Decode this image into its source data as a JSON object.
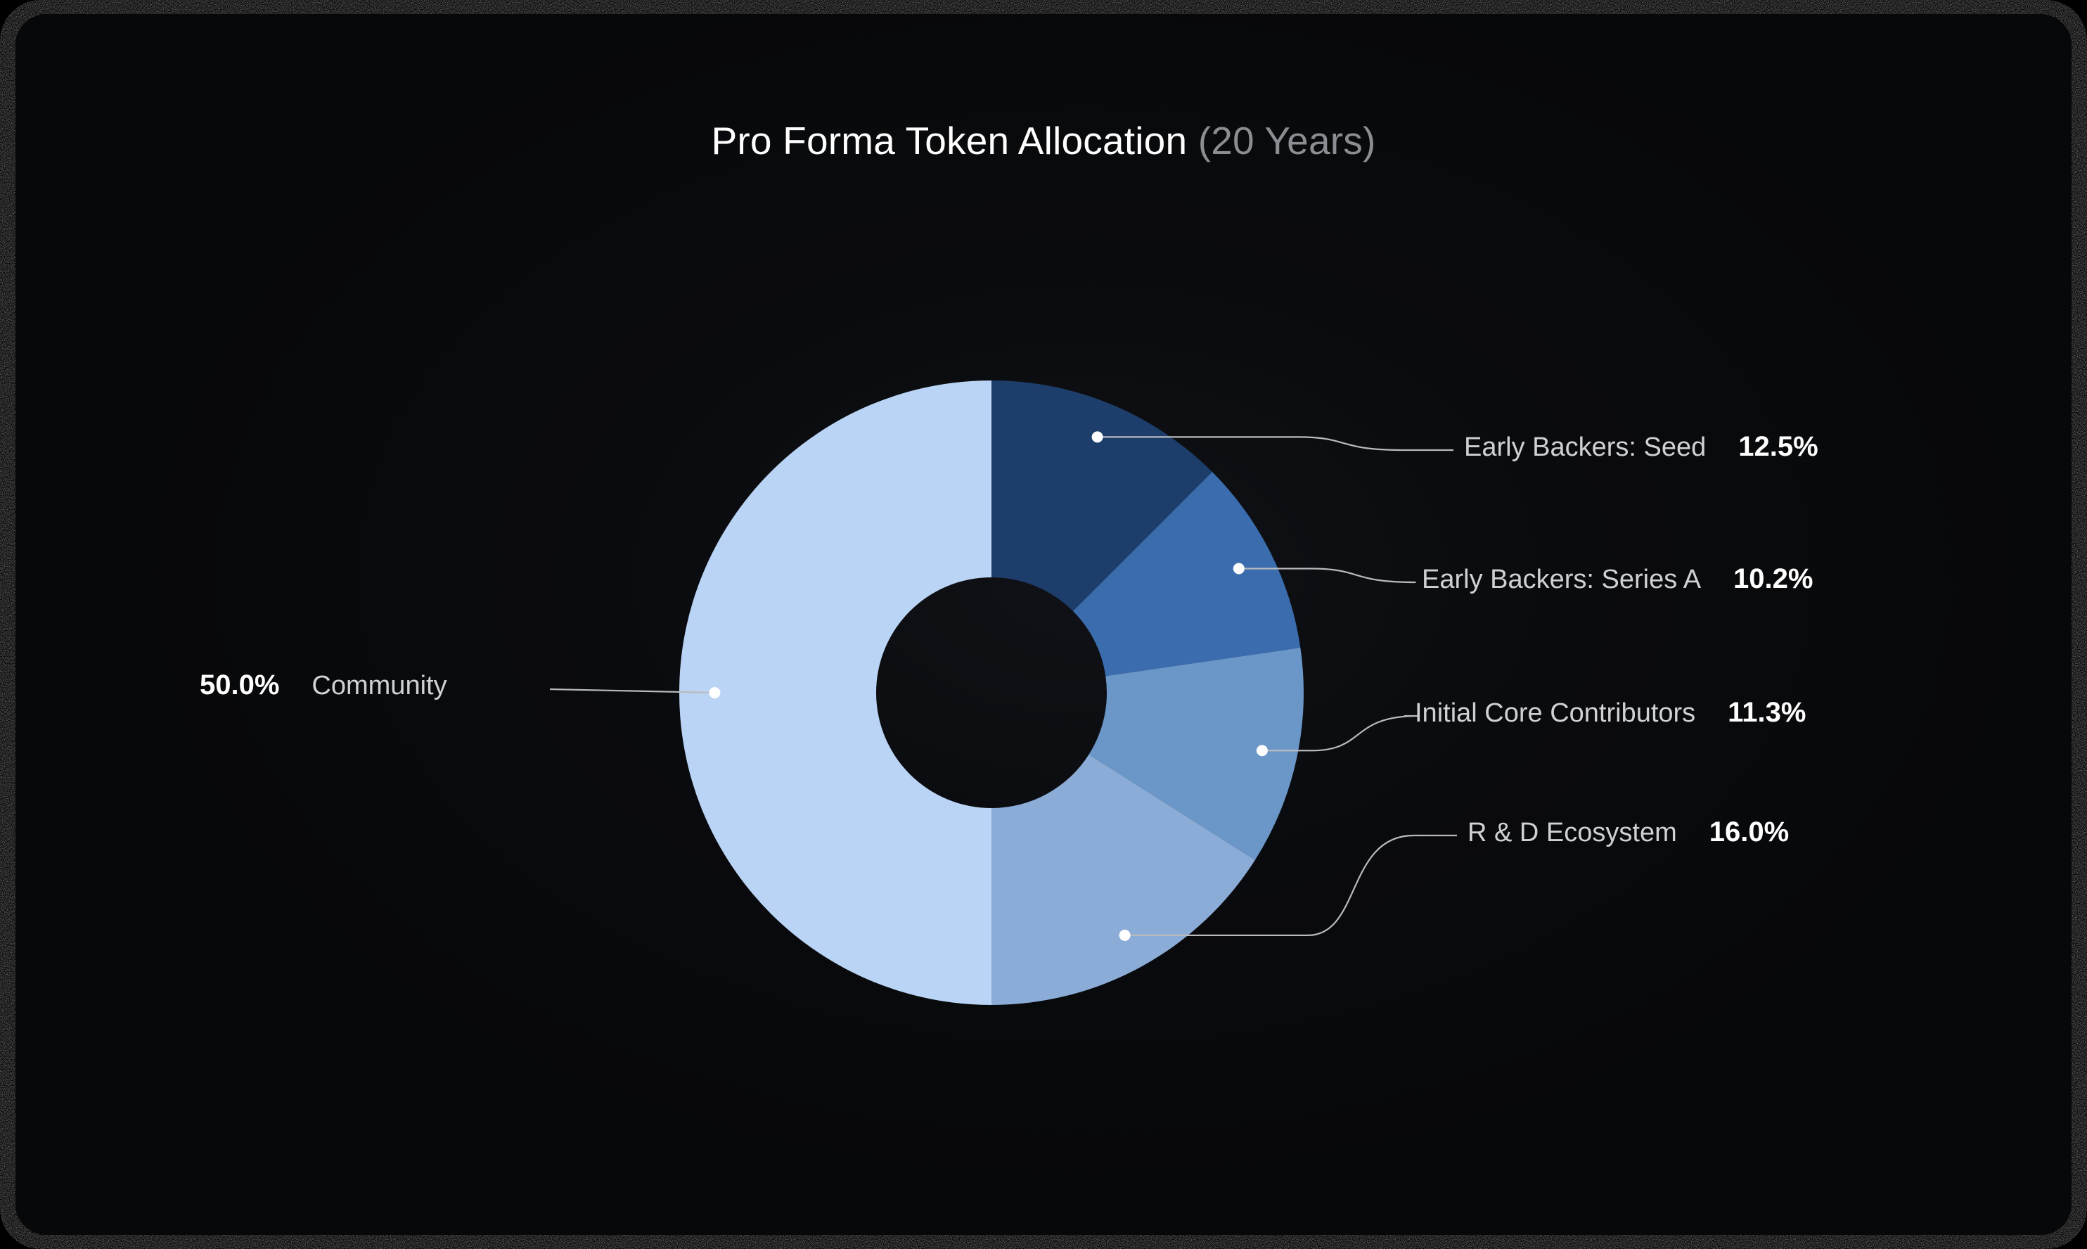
{
  "title": {
    "main": "Pro Forma Token Allocation",
    "sub": "(20 Years)"
  },
  "colors": {
    "background": "#0A0B0E",
    "panel": "#0E1015",
    "frame": "#FFFFFF",
    "label_name": "#CFD1D4",
    "label_value": "#FFFFFF",
    "connector": "#B9BBBE",
    "dot": "#FFFFFF"
  },
  "chart_data": {
    "type": "pie",
    "variant": "donut",
    "title": "Pro Forma Token Allocation (20 Years)",
    "subtitle": "(20 Years)",
    "unit": "%",
    "start_angle_deg": 0,
    "direction": "clockwise",
    "inner_radius_ratio": 0.37,
    "legend": "callout-labels",
    "categories": [
      "Early Backers: Seed",
      "Early Backers: Series A",
      "Initial Core Contributors",
      "R & D Ecosystem",
      "Community"
    ],
    "values": [
      12.5,
      10.2,
      11.3,
      16.0,
      50.0
    ],
    "value_labels": [
      "12.5%",
      "10.2%",
      "11.3%",
      "16.0%",
      "50.0%"
    ],
    "colors": [
      "#1D3E6B",
      "#3A6CAE",
      "#6A96C8",
      "#8BACD6",
      "#BAD4F5"
    ],
    "slices": [
      {
        "label": "Early Backers: Seed",
        "value": 12.5,
        "display": "12.5%",
        "color": "#1D3E6B",
        "side": "right"
      },
      {
        "label": "Early Backers: Series A",
        "value": 10.2,
        "display": "10.2%",
        "color": "#3A6CAE",
        "side": "right"
      },
      {
        "label": "Initial Core Contributors",
        "value": 11.3,
        "display": "11.3%",
        "color": "#6A96C8",
        "side": "right"
      },
      {
        "label": "R & D Ecosystem",
        "value": 16.0,
        "display": "16.0%",
        "color": "#8BACD6",
        "side": "right"
      },
      {
        "label": "Community",
        "value": 50.0,
        "display": "50.0%",
        "color": "#BAD4F5",
        "side": "left"
      }
    ]
  }
}
